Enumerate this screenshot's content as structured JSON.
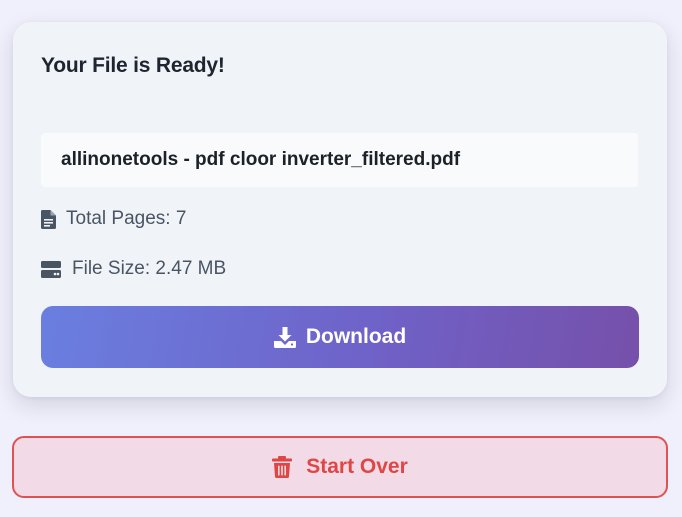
{
  "result_card": {
    "title": "Your File is Ready!",
    "filename": "allinonetools - pdf cloor inverter_filtered.pdf",
    "total_pages": "Total Pages: 7",
    "file_size": "File Size: 2.47 MB",
    "download_label": "Download"
  },
  "actions": {
    "start_over_label": "Start Over"
  },
  "colors": {
    "download_gradient_start": "#6a7fe0",
    "download_gradient_end": "#7650aa",
    "start_over_accent": "#e04646",
    "start_over_bg": "#f2dbe6"
  },
  "icons": {
    "pages": "file-icon",
    "size": "hard-drive-icon",
    "download": "download-icon",
    "start_over": "trash-icon"
  }
}
